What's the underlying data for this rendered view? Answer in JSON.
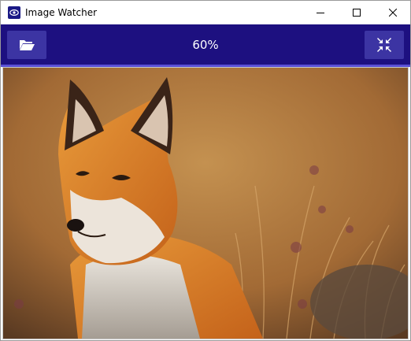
{
  "window": {
    "title": "Image Watcher",
    "controls": [
      "minimize-icon",
      "maximize-icon",
      "close-icon"
    ]
  },
  "toolbar": {
    "open_icon": "folder-open-icon",
    "zoom_level": "60%",
    "fit_icon": "shrink-arrows-icon",
    "colors": {
      "bar": "#1d1080",
      "button": "#3c34a3",
      "accent": "#5a4fd6"
    }
  },
  "image": {
    "subject": "fox-photo"
  }
}
